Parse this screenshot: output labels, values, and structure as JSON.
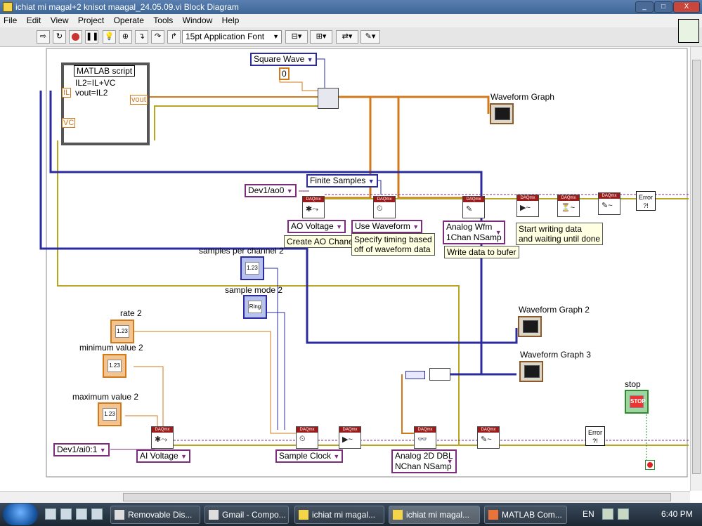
{
  "window": {
    "title": "ichiat mi magal+2 knisot maagal_24.05.09.vi Block Diagram",
    "minimize": "_",
    "maximize": "□",
    "close": "X"
  },
  "menu": [
    "File",
    "Edit",
    "View",
    "Project",
    "Operate",
    "Tools",
    "Window",
    "Help"
  ],
  "toolbar": {
    "font": "15pt Application Font"
  },
  "matlab": {
    "title": "MATLAB script",
    "line1": "IL2=IL+VC",
    "line2": "vout=IL2",
    "in1": "IL",
    "in2": "VC",
    "out": "vout"
  },
  "constants": {
    "square_wave": "Square Wave",
    "zero": "0",
    "finite_samples": "Finite Samples",
    "dev_ao": "Dev1/ao0",
    "dev_ai": "Dev1/ai0:1"
  },
  "selectors": {
    "ao_voltage": "AO Voltage",
    "use_waveform": "Use Waveform",
    "analog_wfm_1": "Analog Wfm",
    "analog_wfm_2": "1Chan NSamp",
    "ai_voltage": "AI Voltage",
    "sample_clock": "Sample Clock",
    "analog_2d_1": "Analog 2D DBL",
    "analog_2d_2": "NChan NSamp"
  },
  "notes": {
    "create_ao": "Create AO Chanel",
    "timing_1": "Specify timing based",
    "timing_2": "off of waveform data",
    "write_buf": "Write data to bufer",
    "start_1": "Start writing data",
    "start_2": "and waiting until done"
  },
  "labels": {
    "waveform_graph": "Waveform Graph",
    "waveform_graph_2": "Waveform Graph 2",
    "waveform_graph_3": "Waveform Graph 3",
    "samples_per_channel": "samples per channel 2",
    "sample_mode": "sample mode 2",
    "rate": "rate 2",
    "min_value": "minimum value 2",
    "max_value": "maximum value 2",
    "stop": "stop"
  },
  "icons": {
    "num_123": "1.23",
    "dbl": "DBL",
    "ring": "Ring",
    "i32": "I32",
    "stop_btn": "STOP",
    "tf": "TF",
    "error": "Error ?!",
    "daqmx": "DAQmx"
  },
  "taskbar": {
    "items": [
      "Removable Dis...",
      "Gmail - Compo...",
      "ichiat mi magal...",
      "ichiat mi magal...",
      "MATLAB Com..."
    ],
    "lang": "EN",
    "time": "6:40 PM"
  },
  "colors": {
    "wire_orange": "#d27a1a",
    "wire_blue": "#2b2ba0",
    "wire_purple": "#7b2d7b",
    "wire_yellow": "#b8a520",
    "wire_brown": "#8a5a2a"
  }
}
